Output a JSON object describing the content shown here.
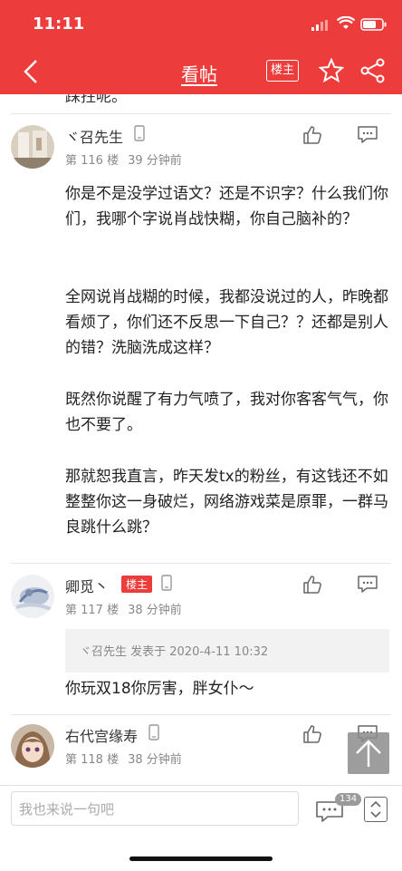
{
  "status": {
    "time": "11:11"
  },
  "nav": {
    "title": "看帖",
    "louzhu_label": "楼主"
  },
  "cut_text": "踩拄呢。",
  "posts": [
    {
      "username": "ヾ召先生",
      "floor": "第 116 楼",
      "time_ago": "39 分钟前",
      "paragraphs": [
        "你是不是没学过语文？还是不识字？什么我们你们，我哪个字说肖战快糊，你自己脑补的？",
        "全网说肖战糊的时候，我都没说过的人，昨晚都看烦了，你们还不反思一下自己？？还都是别人的错？洗脑洗成这样？",
        "既然你说醒了有力气喷了，我对你客客气气，你也不要了。",
        "那就恕我直言，昨天发tx的粉丝，有这钱还不如整整你这一身破烂，网络游戏菜是原罪，一群马良跳什么跳？"
      ]
    },
    {
      "username": "卿觅丶",
      "badge": "楼主",
      "floor": "第 117 楼",
      "time_ago": "38 分钟前",
      "quote": "ヾ召先生 发表于 2020-4-11 10:32",
      "paragraphs": [
        "你玩双18你厉害，胖女仆～"
      ]
    },
    {
      "username": "右代宫缘寿",
      "floor": "第 118 楼",
      "time_ago": "38 分钟前"
    }
  ],
  "bottom": {
    "placeholder": "我也来说一句吧",
    "comment_count": "134"
  },
  "colors": {
    "brand": "#ec3c3c",
    "meta": "#888888",
    "quote_bg": "#f2f2f2"
  }
}
